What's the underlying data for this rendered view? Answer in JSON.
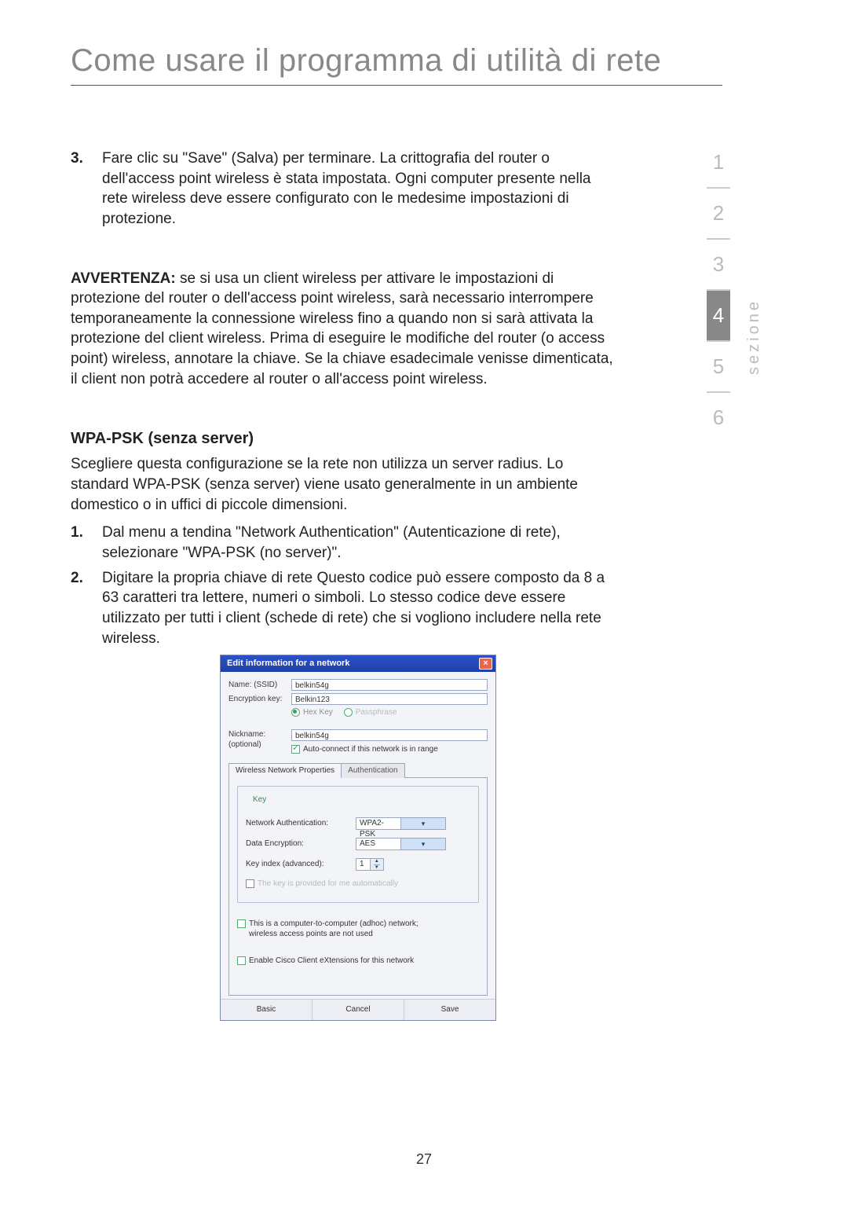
{
  "title": "Come usare il programma di utilità di rete",
  "section_label": "sezione",
  "section_nav": [
    "1",
    "2",
    "3",
    "4",
    "5",
    "6"
  ],
  "section_active_index": 3,
  "page_number": "27",
  "step3_num": "3.",
  "step3_text": "Fare clic su \"Save\"  (Salva) per terminare. La crittografia del router o dell'access point wireless è stata impostata. Ogni computer presente nella rete wireless deve essere configurato con le medesime impostazioni di protezione.",
  "warn_label": "AVVERTENZA:",
  "warn_text": " se si usa un client wireless per attivare le impostazioni di protezione del router o dell'access point wireless, sarà necessario interrompere temporaneamente la connessione wireless fino a quando non si sarà attivata la protezione del client wireless. Prima di eseguire le modifiche del router (o access point) wireless, annotare la chiave. Se la chiave esadecimale venisse dimenticata, il client non potrà accedere al router o all'access point wireless.",
  "wpa_heading": "WPA-PSK (senza server)",
  "wpa_intro": "Scegliere questa configurazione se la rete non utilizza un server radius. Lo standard WPA-PSK (senza server) viene usato generalmente in un ambiente domestico o in uffici di piccole dimensioni.",
  "step1_num": "1.",
  "step1_text": "Dal menu a tendina \"Network Authentication\" (Autenticazione di rete), selezionare \"WPA-PSK (no server)\".",
  "step2_num": "2.",
  "step2_text": "Digitare la propria chiave di rete Questo codice può essere composto da 8 a 63 caratteri tra lettere, numeri o simboli. Lo stesso codice deve essere utilizzato per tutti i client (schede di rete) che si vogliono includere nella rete wireless.",
  "dialog": {
    "title": "Edit information for a network",
    "close_glyph": "×",
    "name_label": "Name:  (SSID)",
    "name_value": "belkin54g",
    "enc_label": "Encryption key:",
    "enc_value": "Belkin123",
    "radio_hex": "Hex Key",
    "radio_pass": "Passphrase",
    "nick_label1": "Nickname:",
    "nick_label2": "(optional)",
    "nick_value": "belkin54g",
    "autoconnect_label": "Auto-connect if this network is in range",
    "tab1": "Wireless Network Properties",
    "tab2": "Authentication",
    "fieldset_legend": "Key",
    "netauth_label": "Network Authentication:",
    "netauth_value": "WPA2-PSK",
    "dataenc_label": "Data Encryption:",
    "dataenc_value": "AES",
    "keyidx_label": "Key index (advanced):",
    "keyidx_value": "1",
    "autokey_label": "The key is provided for me automatically",
    "adhoc_label1": "This is a computer-to-computer (adhoc) network;",
    "adhoc_label2": "wireless access points are not used",
    "cisco_label": "Enable Cisco Client eXtensions for this network",
    "btn_basic": "Basic",
    "btn_cancel": "Cancel",
    "btn_save": "Save"
  }
}
